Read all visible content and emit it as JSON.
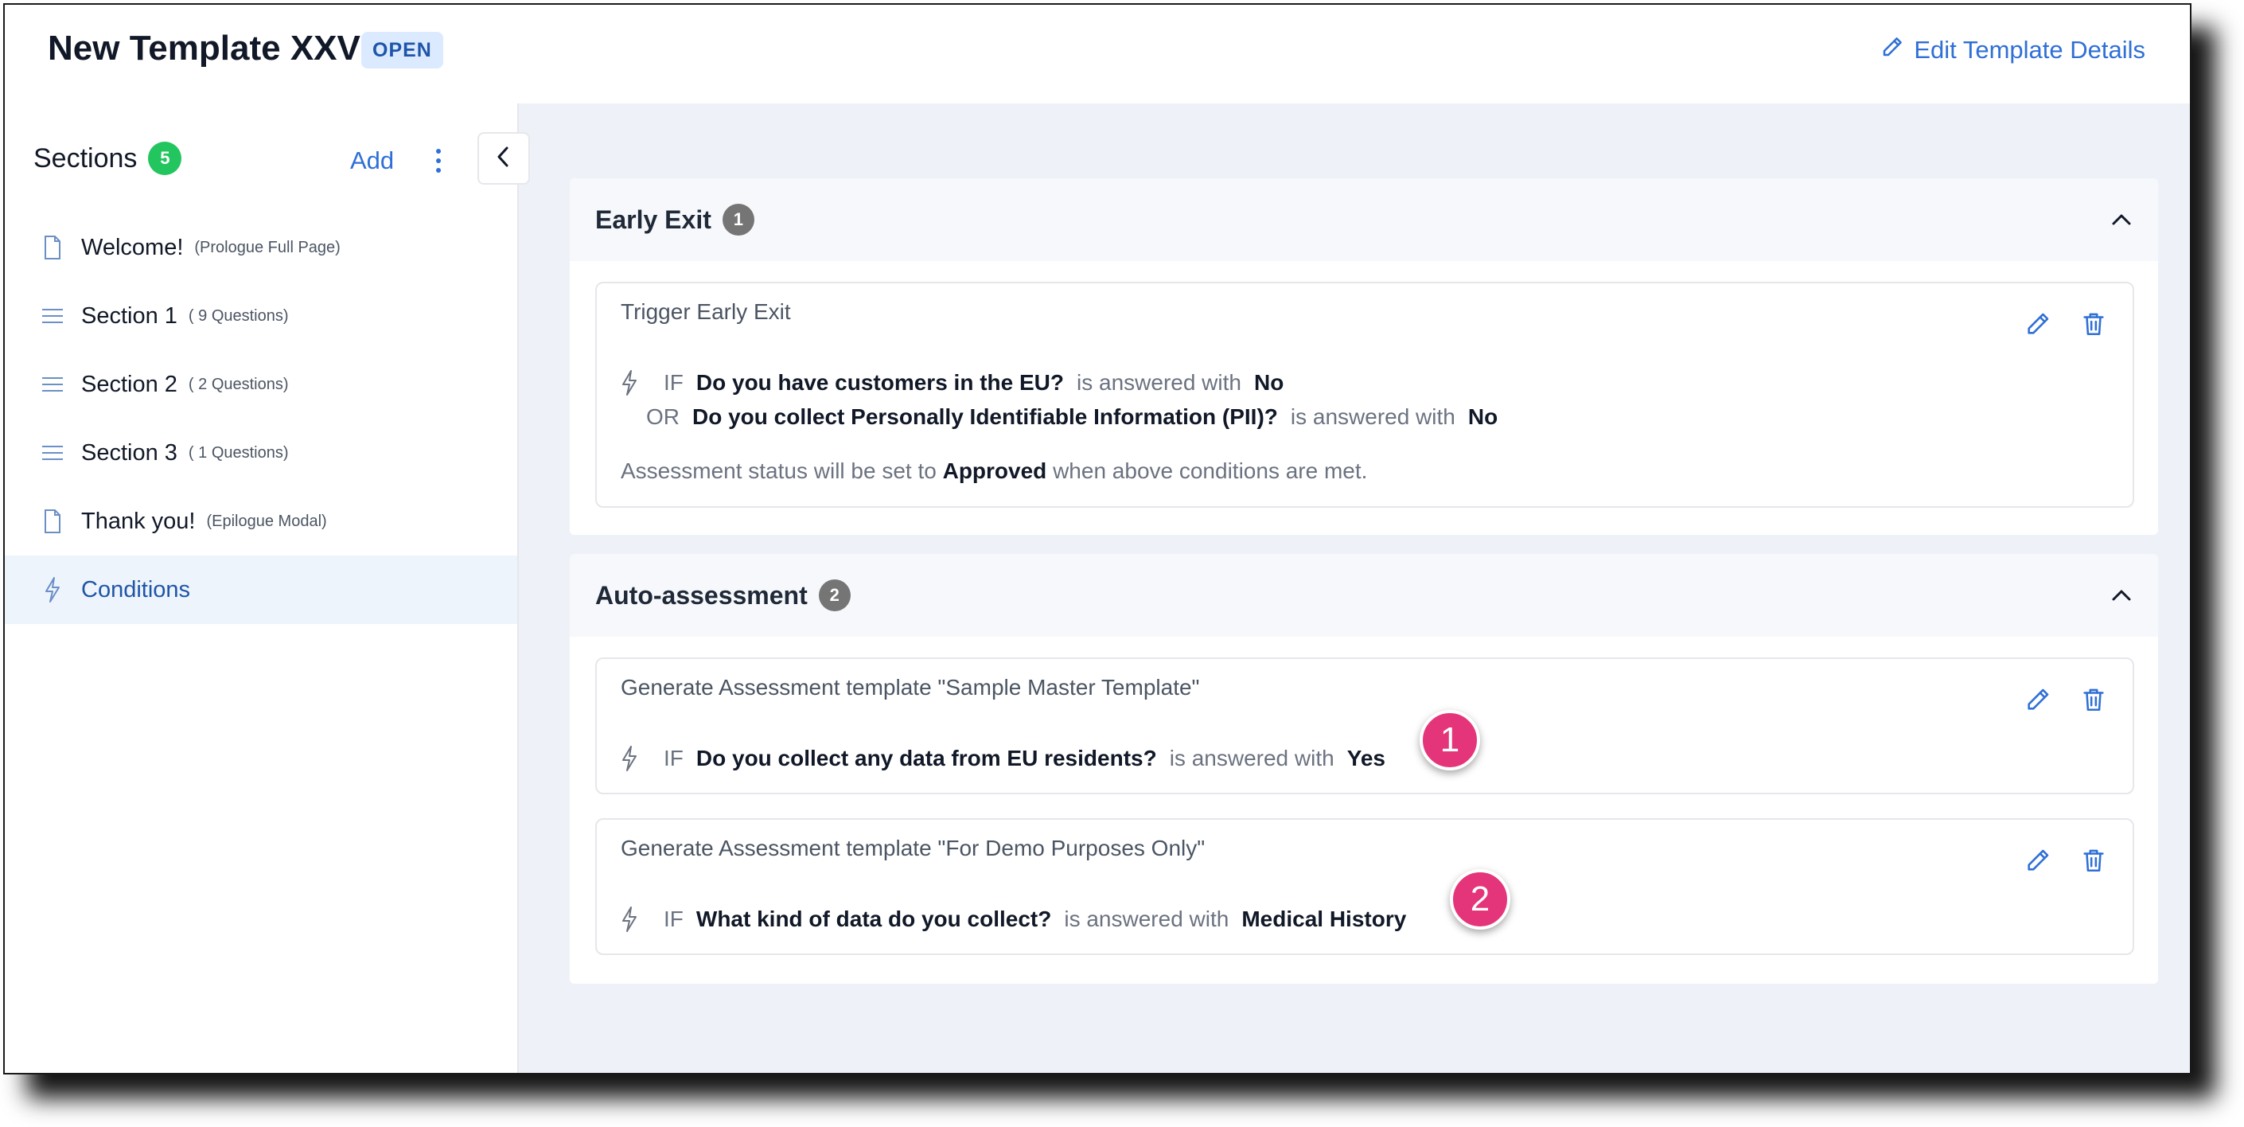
{
  "header": {
    "title": "New Template XXV",
    "status_badge": "OPEN",
    "edit_label": "Edit Template Details"
  },
  "sidebar": {
    "title": "Sections",
    "count": "5",
    "add_label": "Add",
    "items": [
      {
        "label": "Welcome!",
        "sub": "(Prologue Full Page)",
        "icon": "document-icon"
      },
      {
        "label": "Section 1",
        "sub": "( 9 Questions)",
        "icon": "list-icon"
      },
      {
        "label": "Section 2",
        "sub": "( 2 Questions)",
        "icon": "list-icon"
      },
      {
        "label": "Section 3",
        "sub": "( 1 Questions)",
        "icon": "list-icon"
      },
      {
        "label": "Thank you!",
        "sub": "(Epilogue Modal)",
        "icon": "document-icon"
      },
      {
        "label": "Conditions",
        "sub": "",
        "icon": "lightning-icon",
        "active": true
      }
    ]
  },
  "early_exit": {
    "title": "Early Exit",
    "count": "1",
    "card": {
      "title": "Trigger Early Exit",
      "if_kw": "IF",
      "q1": "Do you have customers in the EU?",
      "mid1": "is answered with",
      "a1": "No",
      "or_kw": "OR",
      "q2": "Do you collect Personally Identifiable Information (PII)?",
      "mid2": "is answered with",
      "a2": "No",
      "status_pre": "Assessment status will be set to",
      "status_val": "Approved",
      "status_post": "when above conditions are met."
    }
  },
  "auto_assessment": {
    "title": "Auto-assessment",
    "count": "2",
    "cards": [
      {
        "title": "Generate Assessment template \"Sample Master Template\"",
        "if_kw": "IF",
        "question": "Do you collect any data from EU residents?",
        "mid": "is answered with",
        "answer": "Yes",
        "marker": "1"
      },
      {
        "title": "Generate Assessment template \"For Demo Purposes Only\"",
        "if_kw": "IF",
        "question": "What kind of data do you collect?",
        "mid": "is answered with",
        "answer": "Medical History",
        "marker": "2"
      }
    ]
  },
  "colors": {
    "accent": "#2f6fd6",
    "marker": "#e5357a",
    "count_green": "#22c55e"
  }
}
